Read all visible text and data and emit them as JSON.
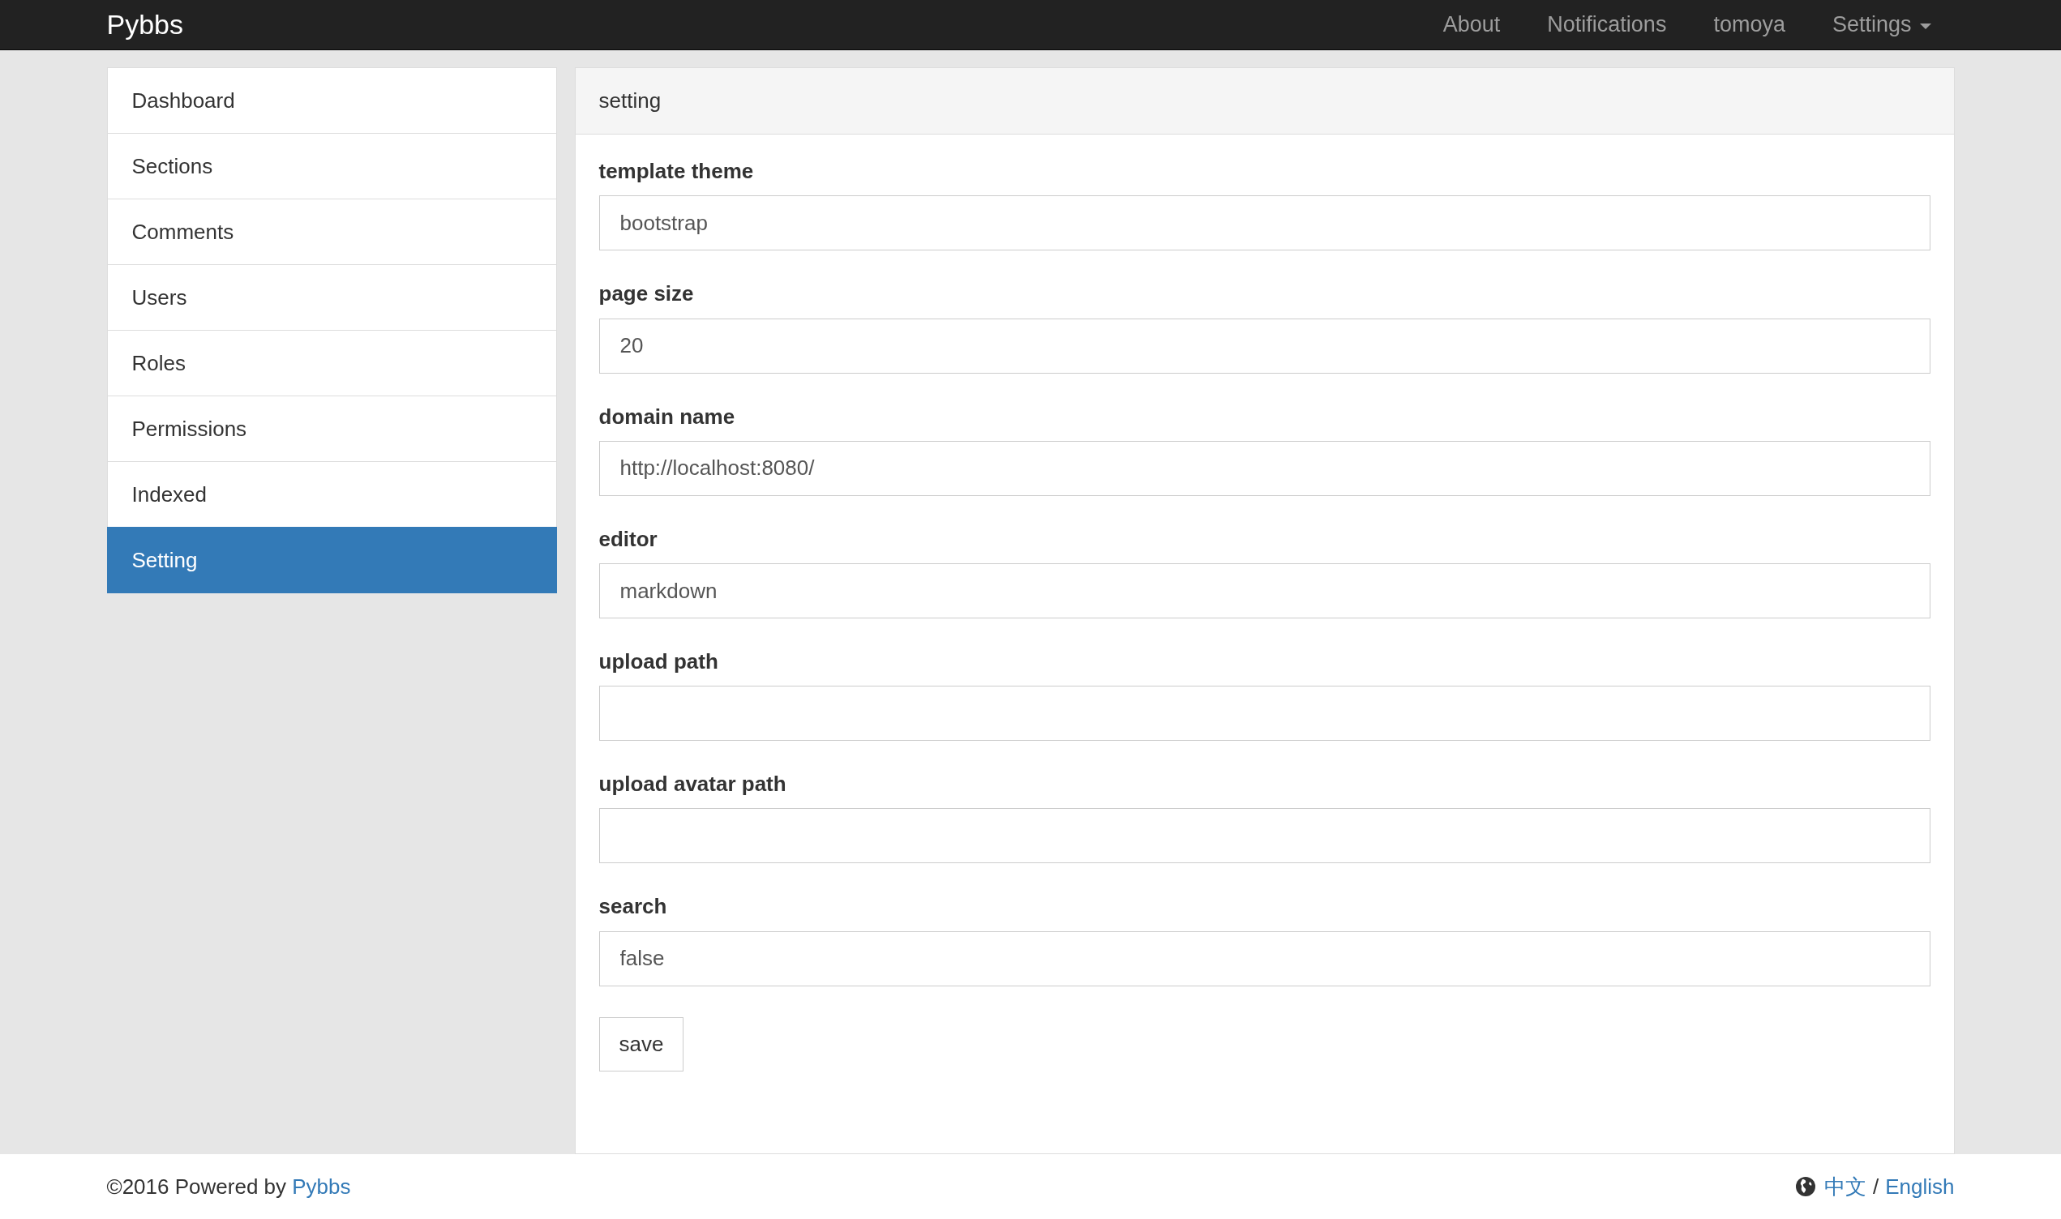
{
  "navbar": {
    "brand": "Pybbs",
    "links": [
      {
        "label": "About",
        "kind": "link"
      },
      {
        "label": "Notifications",
        "kind": "link"
      },
      {
        "label": "tomoya",
        "kind": "link"
      },
      {
        "label": "Settings",
        "kind": "dropdown"
      }
    ]
  },
  "sidebar": {
    "items": [
      {
        "label": "Dashboard",
        "selected": false
      },
      {
        "label": "Sections",
        "selected": false
      },
      {
        "label": "Comments",
        "selected": false
      },
      {
        "label": "Users",
        "selected": false
      },
      {
        "label": "Roles",
        "selected": false
      },
      {
        "label": "Permissions",
        "selected": false
      },
      {
        "label": "Indexed",
        "selected": false
      },
      {
        "label": "Setting",
        "selected": true
      }
    ]
  },
  "panel": {
    "title": "setting",
    "fields": [
      {
        "label": "template theme",
        "value": "bootstrap"
      },
      {
        "label": "page size",
        "value": "20"
      },
      {
        "label": "domain name",
        "value": "http://localhost:8080/"
      },
      {
        "label": "editor",
        "value": "markdown"
      },
      {
        "label": "upload path"
      },
      {
        "label": "upload avatar path"
      },
      {
        "label": "search",
        "value": "false"
      }
    ],
    "button": "save"
  },
  "footer": {
    "copyright": "©2016 Powered by",
    "link": "Pybbs",
    "languages": [
      "中文",
      "English"
    ],
    "separator": "/"
  }
}
